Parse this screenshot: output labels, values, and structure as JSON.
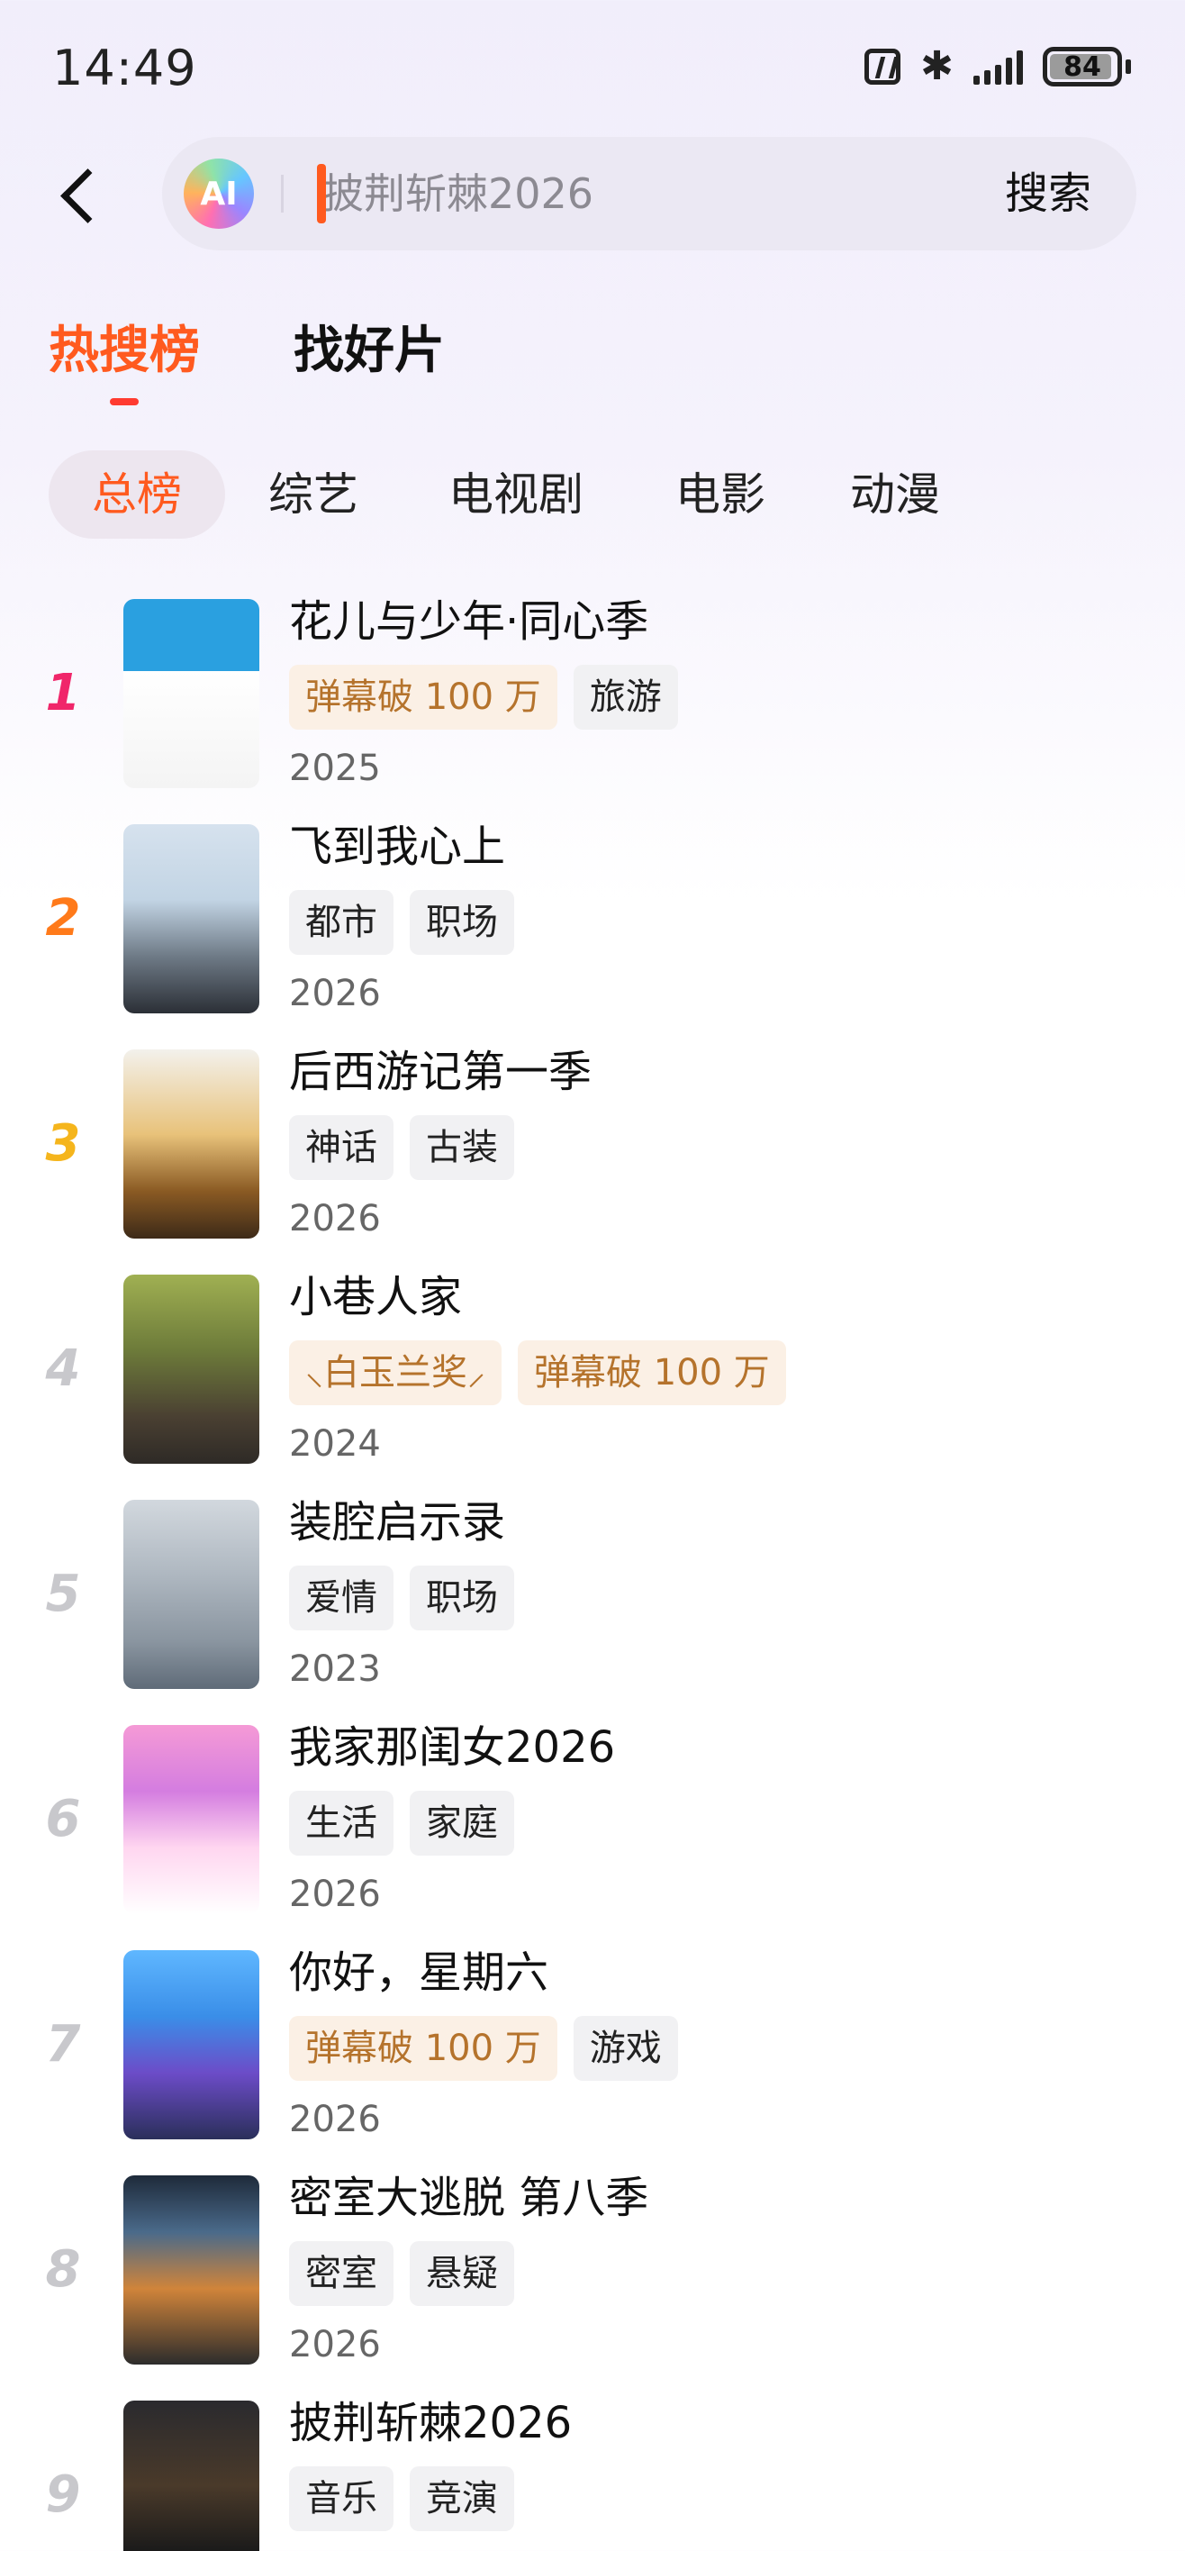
{
  "status_bar": {
    "time": "14:49",
    "battery": "84"
  },
  "search": {
    "ai_label": "AI",
    "query": "披荆斩棘2026",
    "button": "搜索"
  },
  "tabs": [
    {
      "label": "热搜榜",
      "active": true
    },
    {
      "label": "找好片",
      "active": false
    }
  ],
  "categories": [
    {
      "label": "总榜",
      "active": true
    },
    {
      "label": "综艺",
      "active": false
    },
    {
      "label": "电视剧",
      "active": false
    },
    {
      "label": "电影",
      "active": false
    },
    {
      "label": "动漫",
      "active": false
    }
  ],
  "colors": {
    "accent": "#ff5a1f",
    "rank1": "#f0266a",
    "rank2": "#ff7a1a",
    "rank3": "#f5b51c",
    "rank_other": "#c8c8cc",
    "gold_tag_bg": "#fbf0e5",
    "gold_tag_text": "#b5732c"
  },
  "list": [
    {
      "rank": "1",
      "title": "花儿与少年·同心季",
      "tags": [
        {
          "text": "弹幕破 100 万",
          "gold": true
        },
        {
          "text": "旅游",
          "gold": false
        }
      ],
      "year": "2025"
    },
    {
      "rank": "2",
      "title": "飞到我心上",
      "tags": [
        {
          "text": "都市",
          "gold": false
        },
        {
          "text": "职场",
          "gold": false
        }
      ],
      "year": "2026"
    },
    {
      "rank": "3",
      "title": "后西游记第一季",
      "tags": [
        {
          "text": "神话",
          "gold": false
        },
        {
          "text": "古装",
          "gold": false
        }
      ],
      "year": "2026"
    },
    {
      "rank": "4",
      "title": "小巷人家",
      "tags": [
        {
          "text": "白玉兰奖",
          "gold": true
        },
        {
          "text": "弹幕破 100 万",
          "gold": true
        }
      ],
      "year": "2024"
    },
    {
      "rank": "5",
      "title": "装腔启示录",
      "tags": [
        {
          "text": "爱情",
          "gold": false
        },
        {
          "text": "职场",
          "gold": false
        }
      ],
      "year": "2023"
    },
    {
      "rank": "6",
      "title": "我家那闺女2026",
      "tags": [
        {
          "text": "生活",
          "gold": false
        },
        {
          "text": "家庭",
          "gold": false
        }
      ],
      "year": "2026"
    },
    {
      "rank": "7",
      "title": "你好，星期六",
      "tags": [
        {
          "text": "弹幕破 100 万",
          "gold": true
        },
        {
          "text": "游戏",
          "gold": false
        }
      ],
      "year": "2026"
    },
    {
      "rank": "8",
      "title": "密室大逃脱 第八季",
      "tags": [
        {
          "text": "密室",
          "gold": false
        },
        {
          "text": "悬疑",
          "gold": false
        }
      ],
      "year": "2026"
    },
    {
      "rank": "9",
      "title": "披荆斩棘2026",
      "tags": [
        {
          "text": "音乐",
          "gold": false
        },
        {
          "text": "竞演",
          "gold": false
        }
      ],
      "year": ""
    }
  ]
}
